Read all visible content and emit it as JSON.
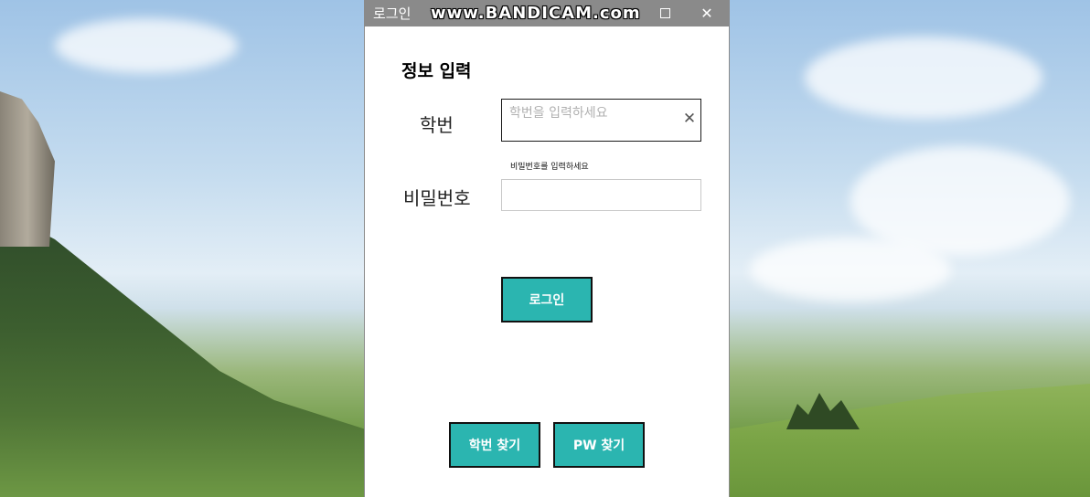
{
  "window": {
    "title": "로그인",
    "watermark": "www.BANDICAM.com",
    "close_glyph": "✕",
    "icons": {
      "maximize": "maximize-icon",
      "close": "close-icon",
      "clear": "clear-icon"
    }
  },
  "form": {
    "heading": "정보 입력",
    "student_id_label": "학번",
    "student_id_placeholder": "학번을 입력하세요",
    "student_id_value": "",
    "clear_glyph": "✕",
    "password_hint": "비밀번호를 입력하세요",
    "password_label": "비밀번호",
    "password_value": ""
  },
  "buttons": {
    "login": "로그인",
    "find_id": "학번 찾기",
    "find_pw": "PW 찾기"
  },
  "colors": {
    "accent": "#2bb5b0",
    "titlebar": "#8a8a8a"
  }
}
